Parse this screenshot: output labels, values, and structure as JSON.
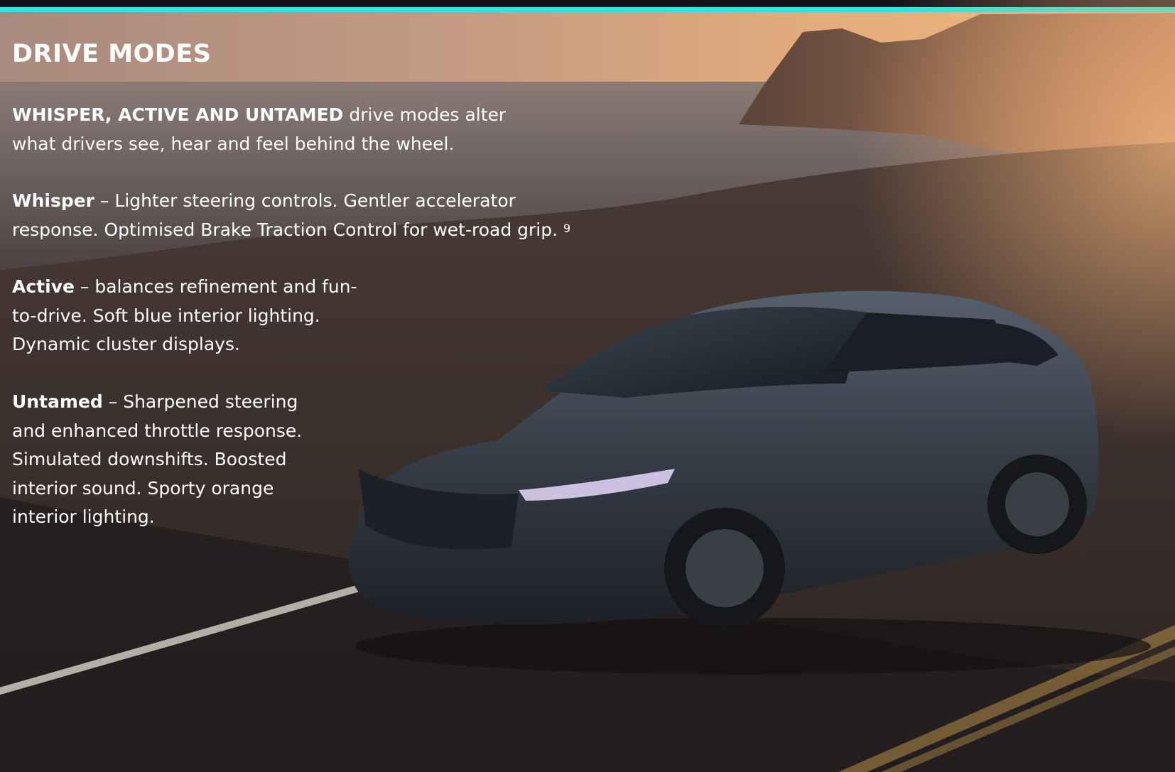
{
  "page": {
    "title": "DRIVE MODES"
  },
  "intro": {
    "bold": "WHISPER, ACTIVE AND UNTAMED",
    "text": " drive modes alter what drivers see, hear and feel behind the wheel."
  },
  "modes": [
    {
      "name": "Whisper",
      "text": " – Lighter steering controls. Gentler accelerator response. Optimised Brake Traction Control for wet-road grip. ",
      "footnote": "9"
    },
    {
      "name": "Active",
      "text": " – balances refinement and fun-to-drive. Soft blue interior lighting. Dynamic cluster displays."
    },
    {
      "name": "Untamed",
      "text": " – Sharpened steering and enhanced throttle response. Simulated downshifts. Boosted interior sound. Sporty orange interior lighting."
    }
  ],
  "colors": {
    "accent": "#29e6df",
    "text": "#ffffff"
  },
  "image": {
    "icon": "car-photo"
  }
}
